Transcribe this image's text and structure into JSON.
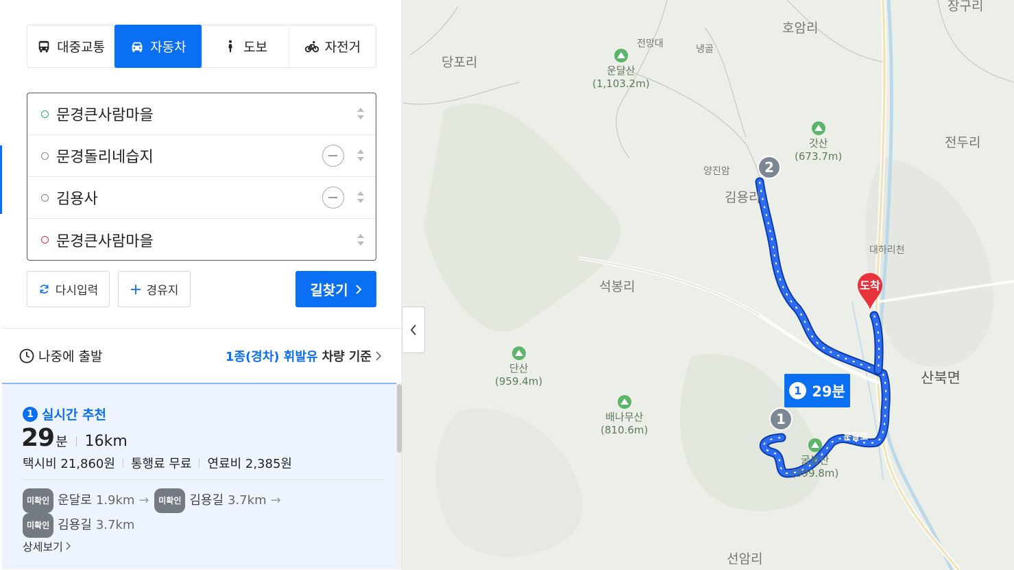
{
  "modes": [
    {
      "label": "대중교통",
      "icon": "bus-icon",
      "active": false
    },
    {
      "label": "자동차",
      "icon": "car-icon",
      "active": true
    },
    {
      "label": "도보",
      "icon": "walk-icon",
      "active": false
    },
    {
      "label": "자전거",
      "icon": "bike-icon",
      "active": false
    }
  ],
  "waypoints": [
    {
      "label": "문경큰사람마을",
      "type": "start"
    },
    {
      "label": "문경돌리네습지",
      "type": "via"
    },
    {
      "label": "김용사",
      "type": "via"
    },
    {
      "label": "문경큰사람마을",
      "type": "end"
    }
  ],
  "buttons": {
    "reset": "다시입력",
    "via": "경유지",
    "search": "길찾기"
  },
  "departure": {
    "label": "나중에 출발"
  },
  "vehicle": {
    "highlight": "1종(경차) 휘발유",
    "suffix": "차량 기준"
  },
  "result": {
    "rank": "1",
    "tag": "실시간 추천",
    "time_value": "29",
    "time_unit": "분",
    "distance": "16km",
    "taxi": "택시비 21,860원",
    "toll": "통행료 무료",
    "fuel": "연료비 2,385원",
    "roads": [
      {
        "tag": "미확인",
        "name": "운달로",
        "dist": "1.9km"
      },
      {
        "tag": "미확인",
        "name": "김용길",
        "dist": "3.7km"
      },
      {
        "tag": "미확인",
        "name": "김용길",
        "dist": "3.7km"
      }
    ],
    "detail": "상세보기"
  },
  "map": {
    "places": [
      {
        "name": "당포리"
      },
      {
        "name": "호암리"
      },
      {
        "name": "전두리"
      },
      {
        "name": "석봉리"
      },
      {
        "name": "산북면"
      },
      {
        "name": "선암리"
      },
      {
        "name": "김용리"
      },
      {
        "name": "장구리"
      }
    ],
    "small_places": [
      {
        "name": "전망대"
      },
      {
        "name": "냉골"
      },
      {
        "name": "양진암"
      },
      {
        "name": "대하리천"
      }
    ],
    "mountains": [
      {
        "name": "운달산",
        "height": "(1,103.2m)"
      },
      {
        "name": "갓산",
        "height": "(673.7m)"
      },
      {
        "name": "단산",
        "height": "(959.4m)"
      },
      {
        "name": "배나무산",
        "height": "(810.6m)"
      },
      {
        "name": "굴봉산",
        "height": "(399.8m)"
      }
    ],
    "route_label": {
      "num": "1",
      "time": "29분"
    },
    "markers": [
      {
        "num": "2"
      },
      {
        "num": "1"
      }
    ],
    "destination": "도착",
    "road_label": "운달로"
  },
  "colors": {
    "accent": "#0a6ff2",
    "route": "#1a56e0",
    "map_bg": "#ecefe9"
  }
}
